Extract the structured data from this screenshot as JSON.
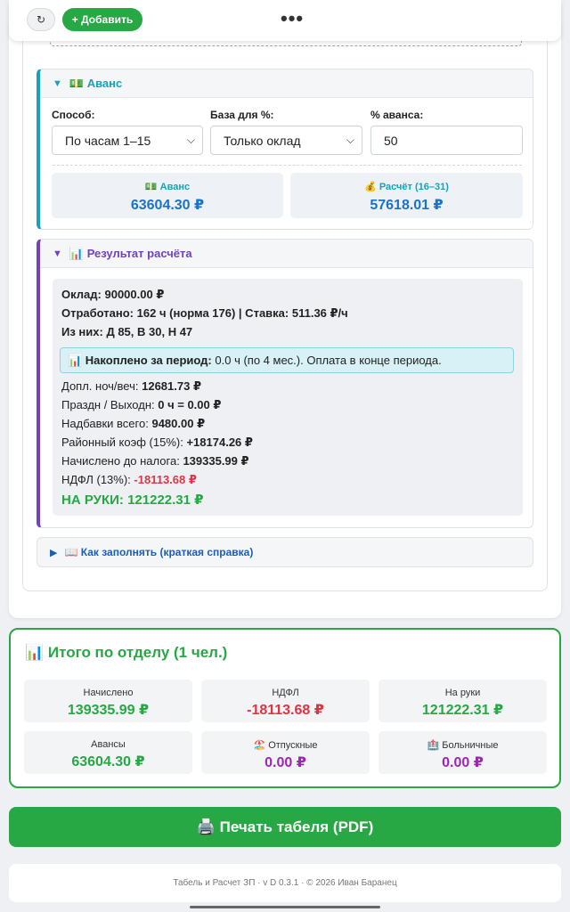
{
  "topbar": {
    "round_btn_glyph": "↻",
    "add_label": "+ Добавить",
    "menu_glyph": "•••"
  },
  "avans": {
    "title": "💵 Аванс",
    "method_label": "Способ:",
    "method_value": "По часам 1–15",
    "base_label": "База для %:",
    "base_value": "Только оклад",
    "percent_label": "% аванса:",
    "percent_value": "50",
    "avans_stat_label": "💵 Аванс",
    "avans_stat_value": "63604.30 ₽",
    "calc_stat_label": "💰 Расчёт (16–31)",
    "calc_stat_value": "57618.01 ₽"
  },
  "result": {
    "title": "📊 Результат расчёта",
    "salary_label": "Оклад:",
    "salary_value": "90000.00 ₽",
    "worked_label": "Отработано:",
    "worked_value": "162 ч",
    "worked_norm": "(норма 176) | Ставка:",
    "rate_value": "511.36 ₽/ч",
    "split_label": "Из них:",
    "split_value": "Д 85, В 30, Н 47",
    "note_bold": "📊 Накоплено за период:",
    "note_text": "0.0 ч (по 4 мес.). Оплата в конце периода.",
    "night_label": "Допл. ноч/веч:",
    "night_value": "12681.73 ₽",
    "holiday_label": "Праздн / Выходн:",
    "holiday_value": "0 ч = 0.00 ₽",
    "bonus_label": "Надбавки всего:",
    "bonus_value": "9480.00 ₽",
    "regional_label": "Районный коэф (15%):",
    "regional_value": "+18174.26 ₽",
    "gross_label": "Начислено до налога:",
    "gross_value": "139335.99 ₽",
    "tax_label": "НДФЛ (13%):",
    "tax_value": "-18113.68 ₽",
    "net_label": "НА РУКИ:",
    "net_value": "121222.31 ₽"
  },
  "help": {
    "label": "📖 Как заполнять (краткая справка)"
  },
  "summary": {
    "title": "📊 Итого по отделу (1 чел.)",
    "accrued_label": "Начислено",
    "accrued_value": "139335.99 ₽",
    "tax_label": "НДФЛ",
    "tax_value": "-18113.68 ₽",
    "net_label": "На руки",
    "net_value": "121222.31 ₽",
    "advances_label": "Авансы",
    "advances_value": "63604.30 ₽",
    "vacation_label": "🏖️ Отпускные",
    "vacation_value": "0.00 ₽",
    "sick_label": "🏥 Больничные",
    "sick_value": "0.00 ₽"
  },
  "print_label": "🖨️ Печать табеля (PDF)",
  "footer_text": "Табель и Расчет ЗП · v D 0.3.1 · © 2026 Иван Баранец",
  "colors": {
    "green": "#28a745",
    "red": "#dc3545",
    "teal": "#17a2b8",
    "purple": "#6f42c1",
    "blue": "#1a73c9",
    "magenta": "#9c27b0"
  }
}
